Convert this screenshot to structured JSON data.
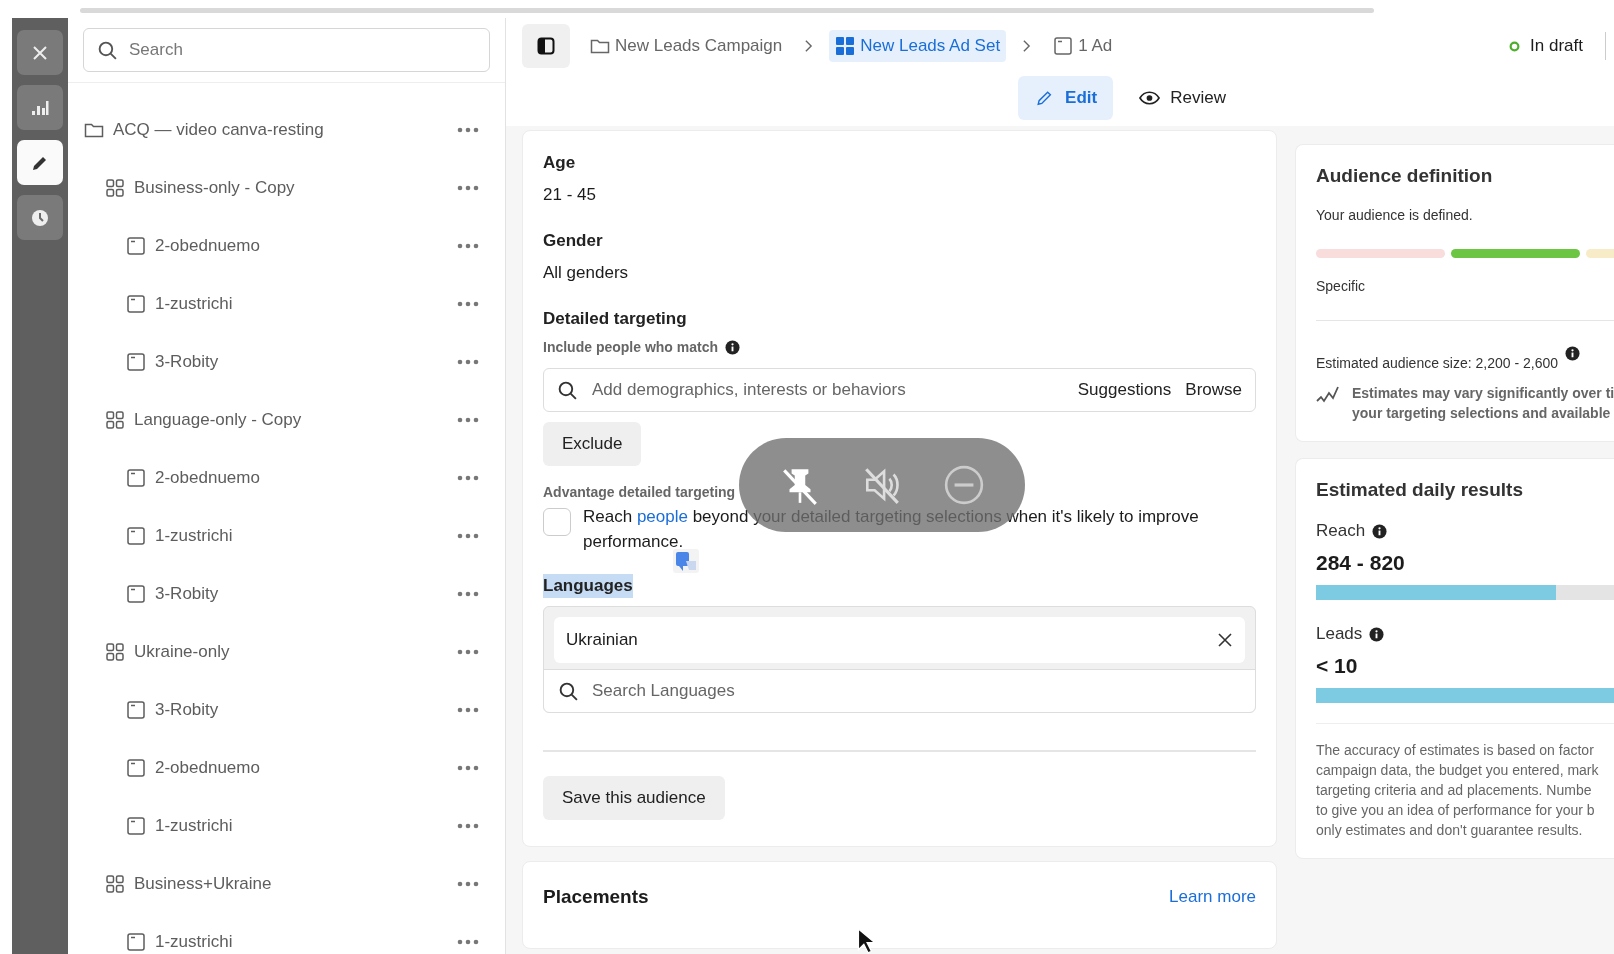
{
  "rail": [
    {
      "kind": "close",
      "selected": false
    },
    {
      "kind": "chart",
      "selected": false
    },
    {
      "kind": "edit",
      "selected": true
    },
    {
      "kind": "history",
      "selected": false
    }
  ],
  "search": {
    "placeholder": "Search"
  },
  "tree": [
    {
      "label": "ACQ — video canva-resting",
      "kind": "campaign",
      "children": [
        {
          "label": "Business-only - Copy",
          "kind": "adset",
          "children": [
            {
              "label": "2-obednuemo",
              "kind": "ad"
            },
            {
              "label": "1-zustrichi",
              "kind": "ad"
            },
            {
              "label": "3-Robity",
              "kind": "ad"
            }
          ]
        },
        {
          "label": "Language-only - Copy",
          "kind": "adset",
          "children": [
            {
              "label": "2-obednuemo",
              "kind": "ad"
            },
            {
              "label": "1-zustrichi",
              "kind": "ad"
            },
            {
              "label": "3-Robity",
              "kind": "ad"
            }
          ]
        },
        {
          "label": "Ukraine-only",
          "kind": "adset",
          "children": [
            {
              "label": "3-Robity",
              "kind": "ad"
            },
            {
              "label": "2-obednuemo",
              "kind": "ad"
            },
            {
              "label": "1-zustrichi",
              "kind": "ad"
            }
          ]
        },
        {
          "label": "Business+Ukraine",
          "kind": "adset",
          "children": [
            {
              "label": "1-zustrichi",
              "kind": "ad"
            }
          ]
        }
      ]
    }
  ],
  "breadcrumbs": [
    {
      "label": "New Leads Campaign",
      "kind": "campaign",
      "selected": false
    },
    {
      "label": "New Leads Ad Set",
      "kind": "adset",
      "selected": true
    },
    {
      "label": "1 Ad",
      "kind": "ad",
      "selected": false
    }
  ],
  "status": {
    "label": "In draft"
  },
  "view_tabs": [
    {
      "label": "Edit",
      "kind": "edit",
      "selected": true
    },
    {
      "label": "Review",
      "kind": "review",
      "selected": false
    }
  ],
  "audience": {
    "fields": [
      {
        "label": "Age",
        "value": "21 - 45"
      },
      {
        "label": "Gender",
        "value": "All genders"
      }
    ],
    "detailed": {
      "title": "Detailed targeting",
      "subtitle": "Include people who match",
      "placeholder": "Add demographics, interests or behaviors",
      "links": [
        "Suggestions",
        "Browse"
      ],
      "exclude": "Exclude"
    },
    "advantage": {
      "title": "Advantage detailed targeting",
      "text_before": "Reach",
      "link": "people",
      "text_after": "beyond your detailed targeting selections when it's likely to improve performance.",
      "checked": false
    },
    "languages": {
      "title": "Languages",
      "highlighted": true,
      "selected": [
        "Ukrainian"
      ],
      "placeholder": "Search Languages"
    },
    "save": "Save this audience"
  },
  "placements": {
    "title": "Placements",
    "link": "Learn more"
  },
  "audience_definition": {
    "title": "Audience definition",
    "status": "Your audience is defined.",
    "segments": [
      {
        "selected": false
      },
      {
        "selected": true
      },
      {
        "selected": false
      }
    ],
    "meter_label": "Specific",
    "size": "Estimated audience size: 2,200 - 2,600",
    "note_lines": [
      "Estimates may vary significantly over ti",
      "your targeting selections and available"
    ]
  },
  "daily_results": {
    "title": "Estimated daily results",
    "metrics": [
      {
        "label": "Reach",
        "value": "284 - 820",
        "level": 0.8
      },
      {
        "label": "Leads",
        "value": "< 10",
        "level": 1
      }
    ],
    "disclaimer_lines": [
      "The accuracy of estimates is based on factor",
      "campaign data, the budget you entered, mark",
      "targeting criteria and ad placements. Numbe",
      "to give you an idea of performance for your b",
      "only estimates and don't guarantee results."
    ]
  }
}
